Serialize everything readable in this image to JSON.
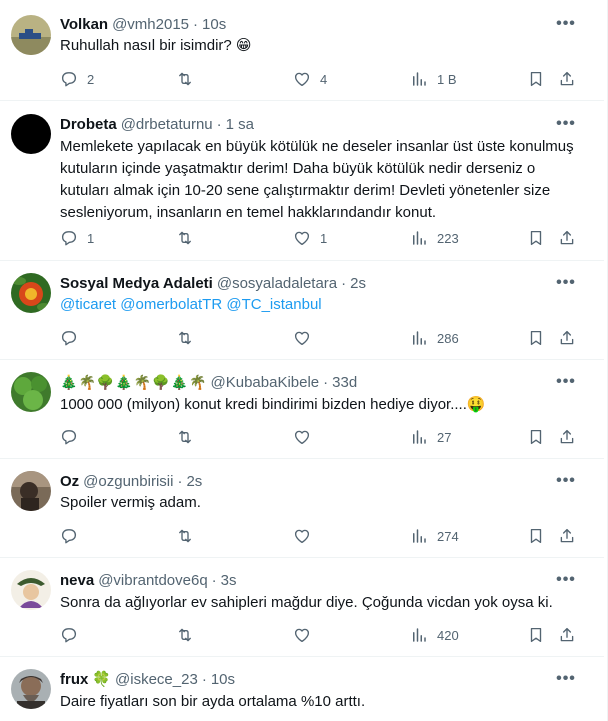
{
  "tweets": [
    {
      "name": "Volkan",
      "handle": "@vmh2015",
      "time": "10s",
      "text": "Ruhullah nasıl bir isimdir? 😁",
      "replies": "2",
      "retweets": "",
      "likes": "4",
      "views": "1 B"
    },
    {
      "name": "Drobeta",
      "handle": "@drbetaturnu",
      "time": "1 sa",
      "text": "Memlekete yapılacak en büyük kötülük ne deseler insanlar üst üste konulmuş kutuların içinde yaşatmaktır derim! Daha büyük kötülük nedir derseniz o kutuları almak için 10-20 sene çalıştırmaktır derim! Devleti yönetenler size sesleniyorum, insanların en temel hakklarındandır konut.",
      "replies": "1",
      "retweets": "",
      "likes": "1",
      "views": "223"
    },
    {
      "name": "Sosyal Medya Adaleti",
      "handle": "@sosyaladaletara",
      "time": "2s",
      "mentions": [
        "@ticaret",
        "@omerbolatTR",
        "@TC_istanbul"
      ],
      "replies": "",
      "retweets": "",
      "likes": "",
      "views": "286"
    },
    {
      "name_emojis": [
        "🎄",
        "🌴",
        "🌳",
        "🎄",
        "🌴",
        "🌳",
        "🎄",
        "🌴"
      ],
      "handle": "@KubabaKibele",
      "time": "33d",
      "text": "1000 000 (milyon) konut kredi bindirimi  bizden hediye diyor....🤑",
      "replies": "",
      "retweets": "",
      "likes": "",
      "views": "27"
    },
    {
      "name": "Oz",
      "handle": "@ozgunbirisii",
      "time": "2s",
      "text": "Spoiler vermiş adam.",
      "replies": "",
      "retweets": "",
      "likes": "",
      "views": "274"
    },
    {
      "name": "neva",
      "handle": "@vibrantdove6q",
      "time": "3s",
      "text": "Sonra da ağlıyorlar ev sahipleri mağdur diye. Çoğunda vicdan yok oysa ki.",
      "replies": "",
      "retweets": "",
      "likes": "",
      "views": "420"
    },
    {
      "name": "frux",
      "name_emoji": "🍀",
      "handle": "@iskece_23",
      "time": "10s",
      "text": "Daire fiyatları son bir ayda ortalama %10 arttı."
    }
  ],
  "ui": {
    "separator": "·",
    "more_glyph": "•••"
  },
  "colors": {
    "text": "#0f1419",
    "secondary": "#536471",
    "link": "#1d9bf0",
    "border": "#eff3f4"
  }
}
